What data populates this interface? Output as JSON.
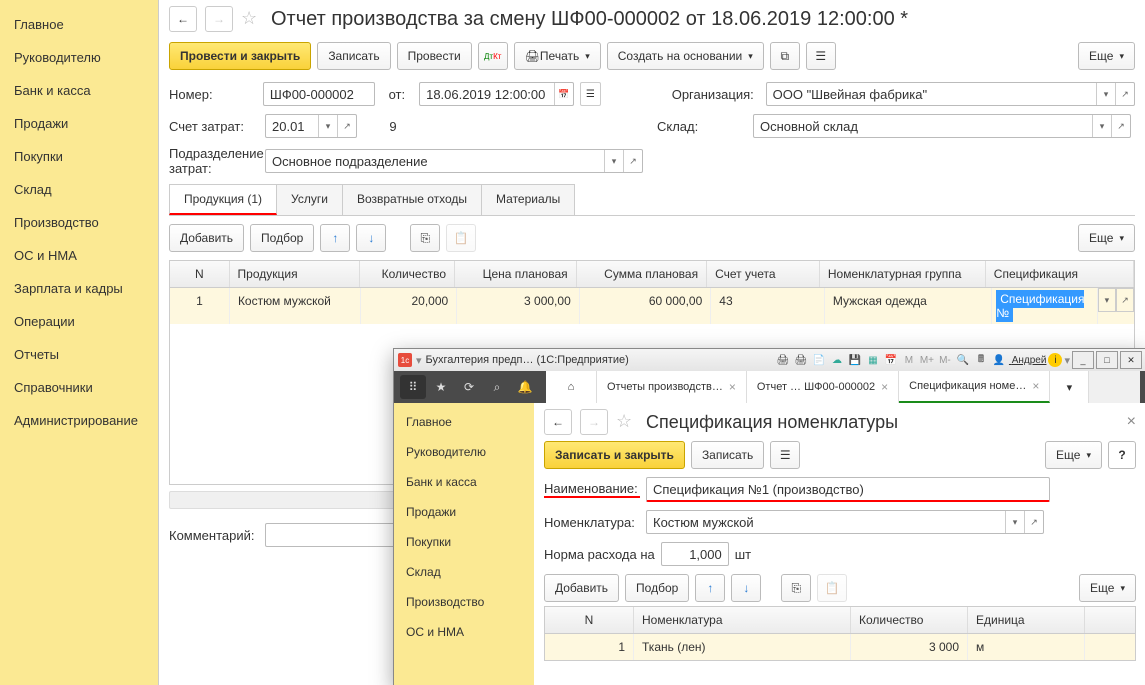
{
  "sidebar": {
    "items": [
      "Главное",
      "Руководителю",
      "Банк и касса",
      "Продажи",
      "Покупки",
      "Склад",
      "Производство",
      "ОС и НМА",
      "Зарплата и кадры",
      "Операции",
      "Отчеты",
      "Справочники",
      "Администрирование"
    ]
  },
  "header": {
    "title": "Отчет производства за смену ШФ00-000002 от 18.06.2019 12:00:00 *"
  },
  "toolbar": {
    "submit": "Провести и закрыть",
    "write": "Записать",
    "post": "Провести",
    "print": "Печать",
    "create": "Создать на основании",
    "more": "Еще"
  },
  "form": {
    "number_label": "Номер:",
    "number": "ШФ00-000002",
    "from_label": "от:",
    "date": "18.06.2019 12:00:00",
    "org_label": "Организация:",
    "org": "ООО \"Швейная фабрика\"",
    "account_label": "Счет затрат:",
    "account": "20.01",
    "account_extra": "9",
    "warehouse_label": "Склад:",
    "warehouse": "Основной склад",
    "division_label": "Подразделение затрат:",
    "division": "Основное подразделение",
    "comment_label": "Комментарий:"
  },
  "tabs": {
    "product": "Продукция (1)",
    "services": "Услуги",
    "returns": "Возвратные отходы",
    "materials": "Материалы"
  },
  "subbar": {
    "add": "Добавить",
    "pick": "Подбор",
    "more": "Еще"
  },
  "table": {
    "headers": {
      "n": "N",
      "product": "Продукция",
      "qty": "Количество",
      "price": "Цена плановая",
      "sum": "Сумма плановая",
      "acct": "Счет учета",
      "group": "Номенклатурная группа",
      "spec": "Спецификация"
    },
    "row": {
      "n": "1",
      "product": "Костюм мужской",
      "qty": "20,000",
      "price": "3 000,00",
      "sum": "60 000,00",
      "acct": "43",
      "group": "Мужская одежда",
      "spec": "Спецификация №"
    }
  },
  "popup": {
    "title_app": "Бухгалтерия предп… (1С:Предприятие)",
    "user": "Андрей",
    "tabs": [
      "Отчеты производств…",
      "Отчет … ШФ00-000002",
      "Спецификация номе…"
    ],
    "sidebar": [
      "Главное",
      "Руководителю",
      "Банк и касса",
      "Продажи",
      "Покупки",
      "Склад",
      "Производство",
      "ОС и НМА"
    ],
    "main_title": "Спецификация номенклатуры",
    "toolbar": {
      "submit": "Записать и закрыть",
      "write": "Записать",
      "more": "Еще"
    },
    "name_label": "Наименование:",
    "name": "Спецификация №1 (производство)",
    "nomen_label": "Номенклатура:",
    "nomen": "Костюм мужской",
    "norm_label": "Норма расхода на",
    "norm": "1,000",
    "norm_unit": "шт",
    "subbar": {
      "add": "Добавить",
      "pick": "Подбор",
      "more": "Еще"
    },
    "table": {
      "headers": {
        "n": "N",
        "nomen": "Номенклатура",
        "qty": "Количество",
        "unit": "Единица"
      },
      "row": {
        "n": "1",
        "nomen": "Ткань (лен)",
        "qty": "3 000",
        "unit": "м"
      }
    }
  }
}
